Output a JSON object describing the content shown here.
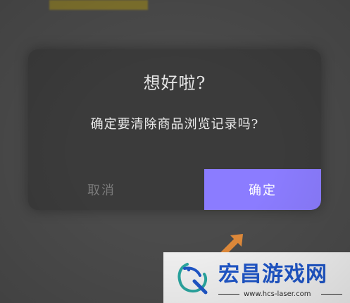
{
  "dialog": {
    "title": "想好啦?",
    "message": "确定要清除商品浏览记录吗?",
    "cancel_label": "取消",
    "confirm_label": "确定"
  },
  "watermark": {
    "brand": "宏昌游戏网",
    "url": "www.hcs-laser.com"
  },
  "colors": {
    "background": "#4b4b4b",
    "dialog": "#3b3b3b",
    "confirm_button": "#8b7cff",
    "arrow": "#e08a3a",
    "brand_blue": "#1f56c8",
    "brand_teal": "#2aa6a0"
  },
  "icons": {
    "arrow": "arrow-up-right-icon",
    "brand_logo": "dragon-logo-icon"
  }
}
